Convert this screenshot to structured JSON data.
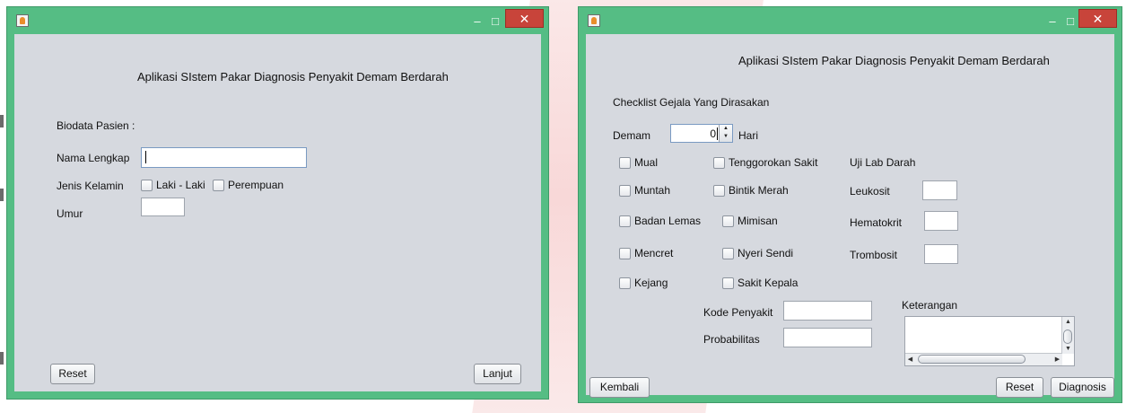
{
  "window1": {
    "title_text": "Aplikasi SIstem Pakar Diagnosis Penyakit Demam Berdarah",
    "section_label": "Biodata Pasien :",
    "name_label": "Nama Lengkap",
    "name_value": "",
    "gender_label": "Jenis Kelamin",
    "gender_options": [
      "Laki - Laki",
      "Perempuan"
    ],
    "age_label": "Umur",
    "age_value": "",
    "reset_label": "Reset",
    "next_label": "Lanjut",
    "minimize_glyph": "–",
    "maximize_glyph": "□",
    "close_glyph": "✕"
  },
  "window2": {
    "title_text": "Aplikasi SIstem Pakar Diagnosis Penyakit Demam Berdarah",
    "section_label": "Checklist Gejala Yang Dirasakan",
    "fever_label": "Demam",
    "fever_value": "0",
    "fever_unit": "Hari",
    "symptoms_col1": [
      "Mual",
      "Muntah",
      "Badan Lemas",
      "Mencret",
      "Kejang"
    ],
    "symptoms_col2": [
      "Tenggorokan Sakit",
      "Bintik Merah",
      "Mimisan",
      "Nyeri Sendi",
      "Sakit Kepala"
    ],
    "lab_title": "Uji Lab Darah",
    "lab_fields": [
      {
        "label": "Leukosit",
        "value": ""
      },
      {
        "label": "Hematokrit",
        "value": ""
      },
      {
        "label": "Trombosit",
        "value": ""
      }
    ],
    "disease_code_label": "Kode Penyakit",
    "disease_code_value": "",
    "probability_label": "Probabilitas",
    "probability_value": "",
    "notes_label": "Keterangan",
    "back_label": "Kembali",
    "reset_label": "Reset",
    "diagnose_label": "Diagnosis",
    "minimize_glyph": "–",
    "maximize_glyph": "□",
    "close_glyph": "✕"
  }
}
